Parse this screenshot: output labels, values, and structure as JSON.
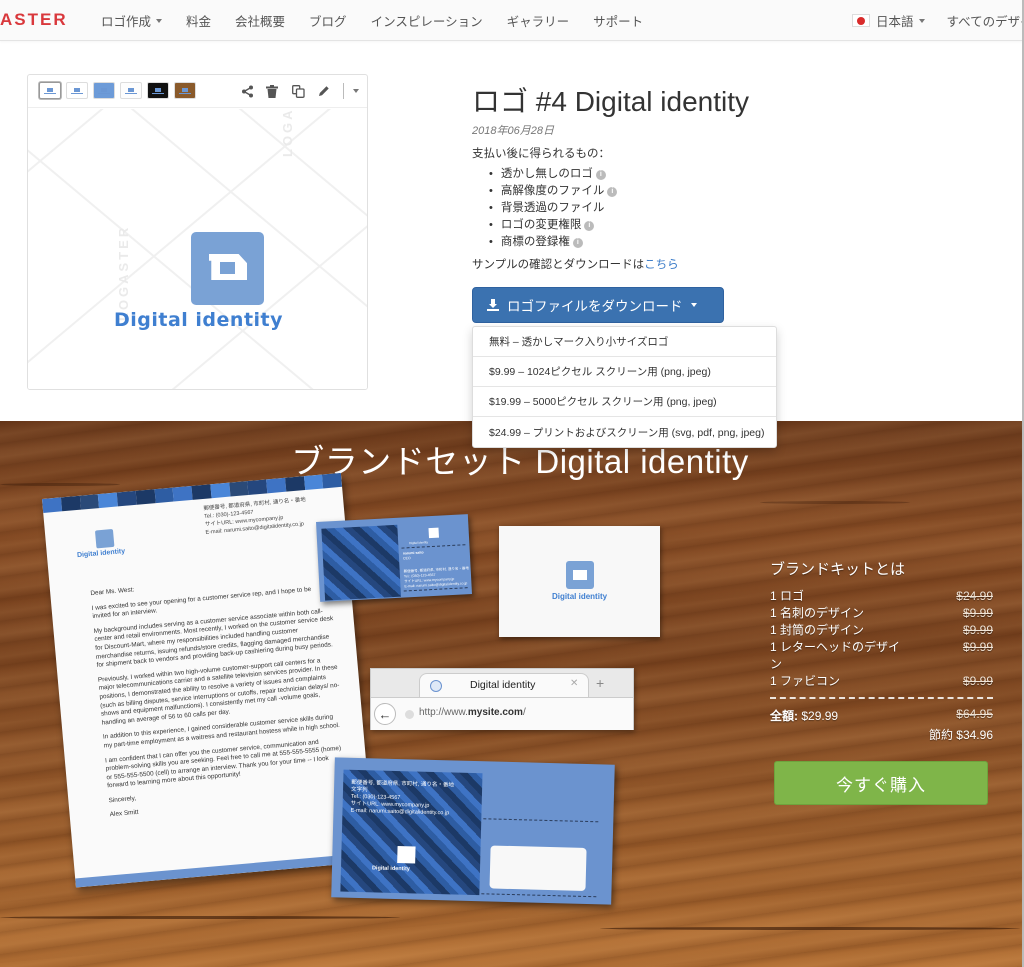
{
  "header": {
    "logo_text": "ASTER",
    "nav": [
      {
        "label": "ロゴ作成",
        "has_caret": true
      },
      {
        "label": "料金"
      },
      {
        "label": "会社概要"
      },
      {
        "label": "ブログ"
      },
      {
        "label": "インスピレーション"
      },
      {
        "label": "ギャラリー"
      },
      {
        "label": "サポート"
      }
    ],
    "language": "日本語",
    "all_designs": "すべてのデザイ"
  },
  "preview": {
    "thumbnails": [
      "white",
      "white-alt",
      "blue",
      "light",
      "black",
      "wood"
    ],
    "selected_thumbnail": 0,
    "tools": [
      "share-icon",
      "trash-icon",
      "copy-icon",
      "pencil-icon",
      "chevron-down-icon"
    ],
    "logo_text": "Digital identity",
    "watermark": "LOGASTER"
  },
  "product": {
    "title": "ロゴ #4 Digital identity",
    "date": "2018年06月28日",
    "benefits_intro": "支払い後に得られるもの：",
    "benefits": [
      {
        "label": "透かし無しのロゴ",
        "info": true
      },
      {
        "label": "高解像度のファイル",
        "info": true
      },
      {
        "label": "背景透過のファイル",
        "info": false
      },
      {
        "label": "ロゴの変更権限",
        "info": true
      },
      {
        "label": "商標の登録権",
        "info": true
      }
    ],
    "sample_text": "サンプルの確認とダウンロードは",
    "sample_link": "こちら",
    "download_button": "ロゴファイルをダウンロード",
    "download_options": [
      "無料 – 透かしマーク入り小サイズロゴ",
      "$9.99 – 1024ピクセル スクリーン用 (png, jpeg)",
      "$19.99 – 5000ピクセル スクリーン用 (png, jpeg)",
      "$24.99 – プリントおよびスクリーン用 (svg, pdf, png, jpeg)"
    ]
  },
  "brand_set": {
    "title": "ブランドセット Digital identity",
    "letterhead": {
      "logo_text": "Digital identity",
      "address": [
        "郵便番号, 都道府県, 市町村, 通り名・番地",
        "Tel.: (030)-123-4567",
        "サイトURL: www.mycompany.jp",
        "E-mail: narumi.saito@digitalidentity.co.jp"
      ],
      "body": [
        "Dear Ms. West:",
        "I was excited to see your opening for a customer service rep, and I hope to be invited for an interview.",
        "My background includes serving as a customer service associate within both call-center and retail environments. Most recently, I worked on the customer service desk for Discount-Mart, where my responsibilities included handling customer merchandise returns, issuing refunds/store credits, flagging damaged merchandise for shipment back to vendors and providing back-up cashiering during busy periods.",
        "Previously, I worked within two high-volume customer-support call centers for a major telecommunications carrier and a satellite television services provider. In these positions, I demonstrated the ability to resolve a variety of issues and complaints (such as billing disputes, service interruptions or cutoffs, repair technician delays/ no-shows and equipment malfunctions). I consistently met my call -volume goals, handling an average of 56 to 60 calls per day.",
        "In addition to this experience, I gained considerable customer service skills during my part-time employment as a waitress and restaurant hostess while in high school.",
        "I am confident that I can offer you the customer service, communication and problem-solving skills you are seeking. Feel free to call me at 555-555-5555 (home) or 555-555-5500 (cell) to arrange an interview. Thank you for your time -- I look forward to learning more about this opportunity!",
        "Sincerely,",
        "Alex Smitt"
      ]
    },
    "business_card": {
      "name": "narumi saito",
      "role": "CEO",
      "address": [
        "郵便番号, 都道府県, 市町村, 通り名・番地",
        "Tel.: (030)-123-4567",
        "サイトURL: www.mycompany.jp",
        "E-mail: narumi.saito@digitalidentity.co.jp"
      ],
      "logo_text": "Digital identity"
    },
    "white_card_logo_text": "Digital identity",
    "browser": {
      "tab_title": "Digital identity",
      "url_prefix": "http://www.",
      "url_domain": "mysite.com",
      "url_suffix": "/"
    },
    "envelope": {
      "address": [
        "郵便番号, 都道府県, 市町村, 通り名・番地",
        "文字列",
        "Tel.: (030)-123-4567",
        "サイトURL: www.mycompany.jp",
        "E-mail: narumi.saito@digitalidentity.co.jp"
      ],
      "logo_text": "Digital identity"
    },
    "kit": {
      "title": "ブランドキットとは",
      "items": [
        {
          "name": "1 ロゴ",
          "price": "$24.99"
        },
        {
          "name": "1 名刺のデザイン",
          "price": "$9.99"
        },
        {
          "name": "1 封筒のデザイン",
          "price": "$9.99"
        },
        {
          "name": "1 レターヘッドのデザイン",
          "price": "$9.99"
        },
        {
          "name": "1 ファビコン",
          "price": "$9.99"
        }
      ],
      "total_label": "全額:",
      "total_price": "$29.99",
      "original_total": "$64.95",
      "savings": "節約 $34.96",
      "buy_button": "今すぐ購入"
    }
  },
  "colors": {
    "brand_red": "#d9383c",
    "primary_blue": "#3b72b0",
    "logo_blue": "#7aa2d5",
    "buy_green": "#7fb549",
    "link_blue": "#3a7bc8"
  }
}
